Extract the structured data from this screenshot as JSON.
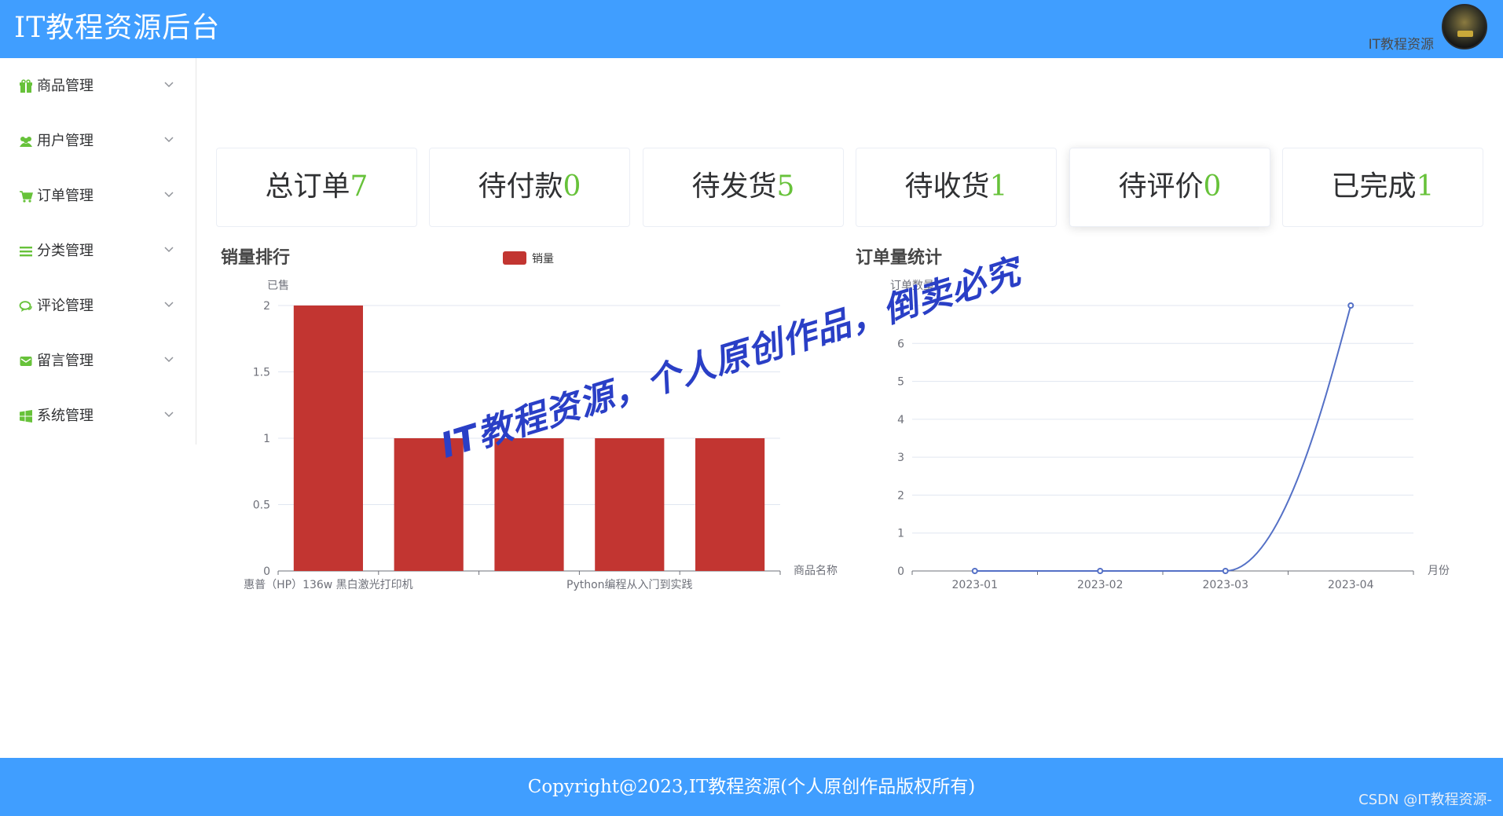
{
  "header": {
    "title": "IT教程资源后台",
    "username": "IT教程资源"
  },
  "sidebar": {
    "items": [
      {
        "label": "商品管理",
        "icon": "gift-icon"
      },
      {
        "label": "用户管理",
        "icon": "users-icon"
      },
      {
        "label": "订单管理",
        "icon": "cart-icon"
      },
      {
        "label": "分类管理",
        "icon": "list-icon"
      },
      {
        "label": "评论管理",
        "icon": "comments-icon"
      },
      {
        "label": "留言管理",
        "icon": "envelope-icon"
      },
      {
        "label": "系统管理",
        "icon": "windows-icon"
      }
    ]
  },
  "stats": [
    {
      "label": "总订单",
      "value": "7"
    },
    {
      "label": "待付款",
      "value": "0"
    },
    {
      "label": "待发货",
      "value": "5"
    },
    {
      "label": "待收货",
      "value": "1"
    },
    {
      "label": "待评价",
      "value": "0"
    },
    {
      "label": "已完成",
      "value": "1"
    }
  ],
  "colors": {
    "header_bg": "#409eff",
    "accent_green": "#67c23a",
    "bar_red": "#c23531",
    "line_blue": "#5470c6"
  },
  "chart_data": [
    {
      "type": "bar",
      "title": "销量排行",
      "legend": [
        "销量"
      ],
      "legend_position": "top-center",
      "ylabel": "已售",
      "xlabel": "商品名称",
      "categories": [
        "惠普（HP）136w 黑白激光打印机",
        "",
        "",
        "Python编程从入门到实践",
        ""
      ],
      "series": [
        {
          "name": "销量",
          "values": [
            2,
            1,
            1,
            1,
            1
          ]
        }
      ],
      "ylim": [
        0,
        2
      ],
      "yticks": [
        "0",
        "0.5",
        "1",
        "1.5",
        "2"
      ],
      "grid": true
    },
    {
      "type": "line",
      "title": "订单量统计",
      "ylabel": "订单数量",
      "xlabel": "月份",
      "x": [
        "2023-01",
        "2023-02",
        "2023-03",
        "2023-04"
      ],
      "series": [
        {
          "values": [
            0,
            0,
            0,
            7
          ]
        }
      ],
      "ylim": [
        0,
        7
      ],
      "yticks": [
        "0",
        "1",
        "2",
        "3",
        "4",
        "5",
        "6",
        "7"
      ],
      "smooth": true,
      "grid": true
    }
  ],
  "watermark": "IT教程资源，个人原创作品，倒卖必究",
  "footer": {
    "copyright": "Copyright@2023,IT教程资源(个人原创作品版权所有)",
    "credit": "CSDN @IT教程资源-"
  }
}
